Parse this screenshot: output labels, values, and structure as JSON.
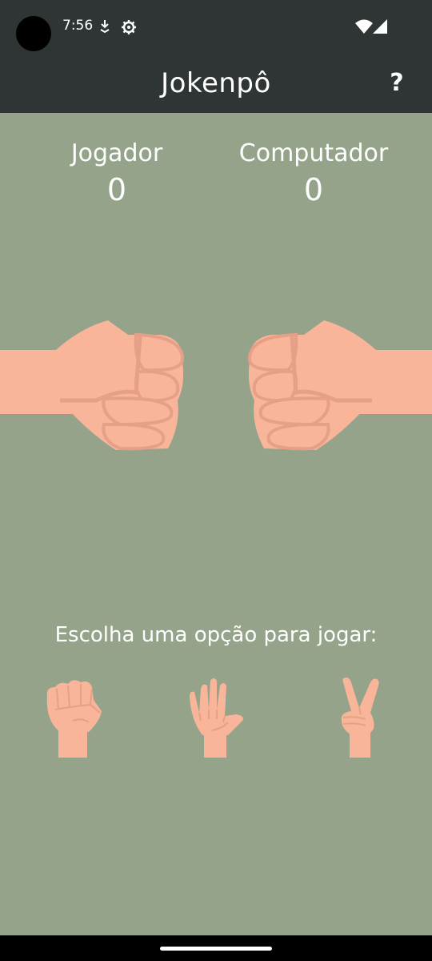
{
  "status_bar": {
    "time": "7:56",
    "icons": [
      "download-icon",
      "settings-gear-icon",
      "wifi-icon",
      "cell-signal-icon"
    ]
  },
  "app_bar": {
    "title": "Jokenpô",
    "help_label": "?"
  },
  "scoreboard": {
    "player_label": "Jogador",
    "player_score": "0",
    "computer_label": "Computador",
    "computer_score": "0"
  },
  "game": {
    "prompt": "Escolha uma opção para jogar:",
    "choices": [
      {
        "name": "rock",
        "icon": "rock-fist-icon"
      },
      {
        "name": "paper",
        "icon": "paper-hand-icon"
      },
      {
        "name": "scissors",
        "icon": "scissors-hand-icon"
      }
    ]
  },
  "colors": {
    "background": "#94a38a",
    "bar": "#2f3435",
    "skin": "#f9b59a",
    "skin_shadow": "#e5a087"
  }
}
